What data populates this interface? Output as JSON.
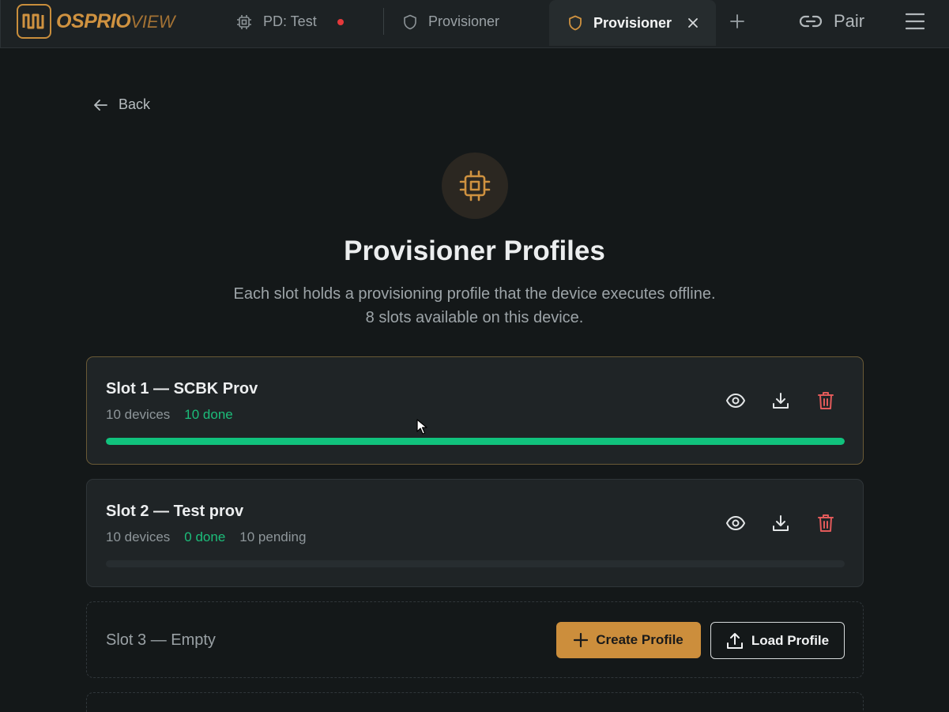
{
  "app": {
    "logo_main": "OSPRIO",
    "logo_sub": "VIEW",
    "accent": "#cc8e3c"
  },
  "tabs": [
    {
      "label": "PD: Test",
      "icon": "chip-icon",
      "status": "recording-dot",
      "status_color": "#e5393b"
    },
    {
      "label": "Provisioner",
      "icon": "shield-icon"
    },
    {
      "label": "Provisioner",
      "icon": "shield-icon",
      "active": true
    }
  ],
  "topbar": {
    "pair_label": "Pair"
  },
  "back_label": "Back",
  "page": {
    "title": "Provisioner Profiles",
    "subtitle_line1": "Each slot holds a provisioning profile that the device executes offline.",
    "subtitle_line2": "8 slots available on this device."
  },
  "slots": [
    {
      "name": "Slot 1 — SCBK Prov",
      "devices": "10 devices",
      "done": "10 done",
      "pending": "",
      "progress_fraction": 1.0
    },
    {
      "name": "Slot 2 — Test prov",
      "devices": "10 devices",
      "done": "0 done",
      "pending": "10 pending",
      "progress_fraction": 0.0
    },
    {
      "name": "Slot 3 — Empty",
      "create_label": "Create Profile",
      "load_label": "Load Profile"
    }
  ],
  "colors": {
    "done_green": "#1cbd7a",
    "delete_red": "#e25a5a"
  }
}
